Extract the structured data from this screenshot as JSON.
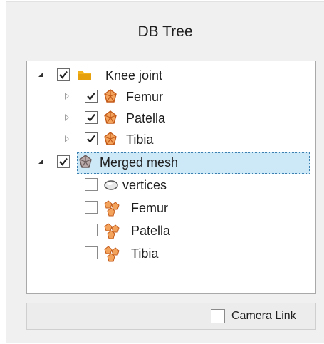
{
  "panel": {
    "title": "DB Tree"
  },
  "tree": {
    "items": [
      {
        "label": "Knee joint",
        "checked": true,
        "icon": "folder-icon"
      },
      {
        "label": "Femur",
        "checked": true,
        "icon": "mesh-icon"
      },
      {
        "label": "Patella",
        "checked": true,
        "icon": "mesh-icon"
      },
      {
        "label": "Tibia",
        "checked": true,
        "icon": "mesh-icon"
      },
      {
        "label": "Merged mesh",
        "checked": true,
        "icon": "mesh-icon",
        "selected": true
      },
      {
        "label": "vertices",
        "checked": false,
        "icon": "point-cloud-icon"
      },
      {
        "label": "Femur",
        "checked": false,
        "icon": "multi-mesh-icon"
      },
      {
        "label": "Patella",
        "checked": false,
        "icon": "multi-mesh-icon"
      },
      {
        "label": "Tibia",
        "checked": false,
        "icon": "multi-mesh-icon"
      }
    ]
  },
  "footer": {
    "camera_link_label": "Camera Link",
    "camera_link_checked": false
  },
  "colors": {
    "selection": "#cde8f7",
    "folder": "#f2b21e",
    "mesh": "#e07b39",
    "merged_mesh": "#8a7a7a"
  }
}
